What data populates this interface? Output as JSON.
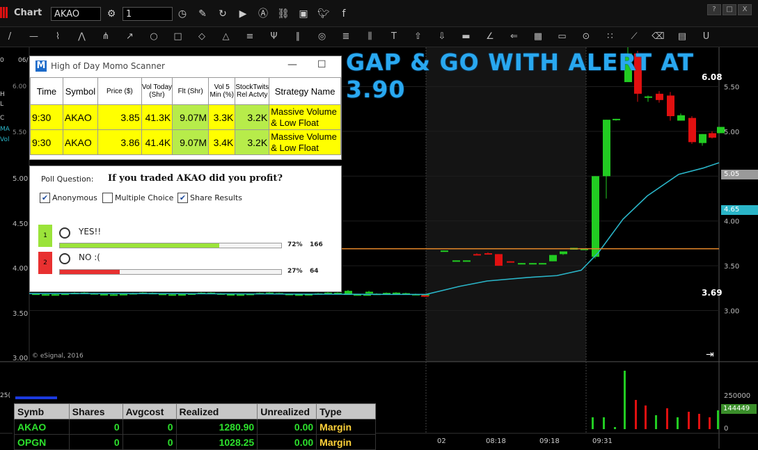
{
  "app": {
    "title": "Chart",
    "symbol": "AKAO",
    "interval": "1"
  },
  "window_buttons": [
    "?",
    "□",
    "X"
  ],
  "toolbar_icons": [
    "line-tool-icon",
    "hline-tool-icon",
    "pencil-icon",
    "wave-icon",
    "fork-icon",
    "arrow-tool-icon",
    "ellipse-icon",
    "rectangle-icon",
    "eraser-icon",
    "triangle-icon",
    "channel-icon",
    "fork-tool-icon",
    "parallel-icon",
    "target-icon",
    "fib-icon",
    "vertical-lines-icon",
    "text-icon",
    "up-arrow-icon",
    "down-arrow-icon",
    "box-icon",
    "angle-icon",
    "back-arrow-icon",
    "grid-icon",
    "mob-icon",
    "td-icon",
    "pti-icon",
    "measure-icon",
    "eraser2-icon",
    "comment-icon",
    "magnet-icon"
  ],
  "headline": "GAP & GO WITH ALERT AT 3.90",
  "chart": {
    "price_labels": [
      "6.00",
      "5.50",
      "5.05",
      "4.65",
      "4.50",
      "4.00",
      "3.50",
      "3.00"
    ],
    "left_price_labels": [
      "5.00",
      "4.50",
      "4.00",
      "3.50",
      "3.00"
    ],
    "level_high": "6.08",
    "level_alert": "3.69",
    "current_price": "5.05",
    "ma_value": "4.65",
    "copyright": "© eSignal, 2016",
    "volume_labels": [
      "250000",
      "144449",
      "0"
    ],
    "time_labels": [
      "02",
      "08:18",
      "09:18",
      "09:31"
    ],
    "left_fragments": [
      "0",
      "H",
      "L",
      "C",
      "MA",
      "Vol",
      "06/",
      "5.50",
      "6.00",
      "25("
    ]
  },
  "scanner": {
    "title": "High of Day Momo Scanner",
    "columns": [
      "Time",
      "Symbol",
      "Price ($)",
      "Vol Today (Shr)",
      "Flt (Shr)",
      "Vol 5 Min (%)",
      "StockTwits Rel Actvty",
      "Strategy Name"
    ],
    "rows": [
      [
        "9:30",
        "AKAO",
        "3.85",
        "41.3K",
        "9.07M",
        "3.3K",
        "3.2K",
        "Massive Volume & Low Float"
      ],
      [
        "9:30",
        "AKAO",
        "3.86",
        "41.4K",
        "9.07M",
        "3.4K",
        "3.2K",
        "Massive Volume & Low Float"
      ]
    ]
  },
  "poll": {
    "question_label": "Poll Question:",
    "question": "If you traded AKAO did you profit?",
    "options": [
      {
        "label": "Anonymous",
        "checked": true
      },
      {
        "label": "Multiple Choice",
        "checked": false
      },
      {
        "label": "Share Results",
        "checked": true
      }
    ],
    "answers": [
      {
        "num": "1",
        "text": "YES!!",
        "percent": "72%",
        "count": "166",
        "fraction": 0.72,
        "color": "#9be33a"
      },
      {
        "num": "2",
        "text": "NO :(",
        "percent": "27%",
        "count": "64",
        "fraction": 0.27,
        "color": "#e83030"
      }
    ]
  },
  "positions": {
    "columns": [
      "Symb",
      "Shares",
      "Avgcost",
      "Realized",
      "Unrealized",
      "Type"
    ],
    "rows": [
      [
        "AKAO",
        "0",
        "0",
        "1280.90",
        "0.00",
        "Margin"
      ],
      [
        "OPGN",
        "0",
        "0",
        "1028.25",
        "0.00",
        "Margin"
      ]
    ]
  },
  "colors": {
    "up": "#22cc22",
    "down": "#e01010",
    "ma": "#2ab5c8",
    "level": "#e8892a",
    "headline": "#29a8f0"
  }
}
